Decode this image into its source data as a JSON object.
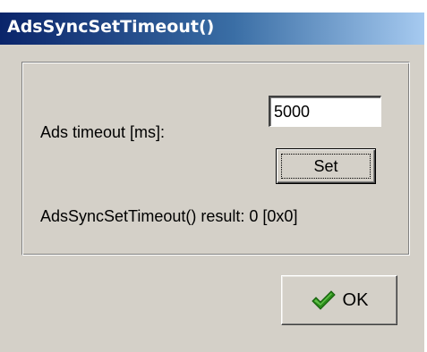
{
  "window": {
    "title": "AdsSyncSetTimeout()"
  },
  "form": {
    "timeout_label": "Ads timeout [ms]:",
    "timeout_value": "5000",
    "set_label": "Set",
    "result_text": "AdsSyncSetTimeout() result: 0 [0x0]"
  },
  "footer": {
    "ok_label": "OK",
    "ok_icon": "checkmark-icon"
  },
  "colors": {
    "titlebar_start": "#0a246a",
    "titlebar_end": "#a6caf0",
    "dialog_background": "#d4d0c8",
    "checkmark_green": "#2a8a1a"
  }
}
